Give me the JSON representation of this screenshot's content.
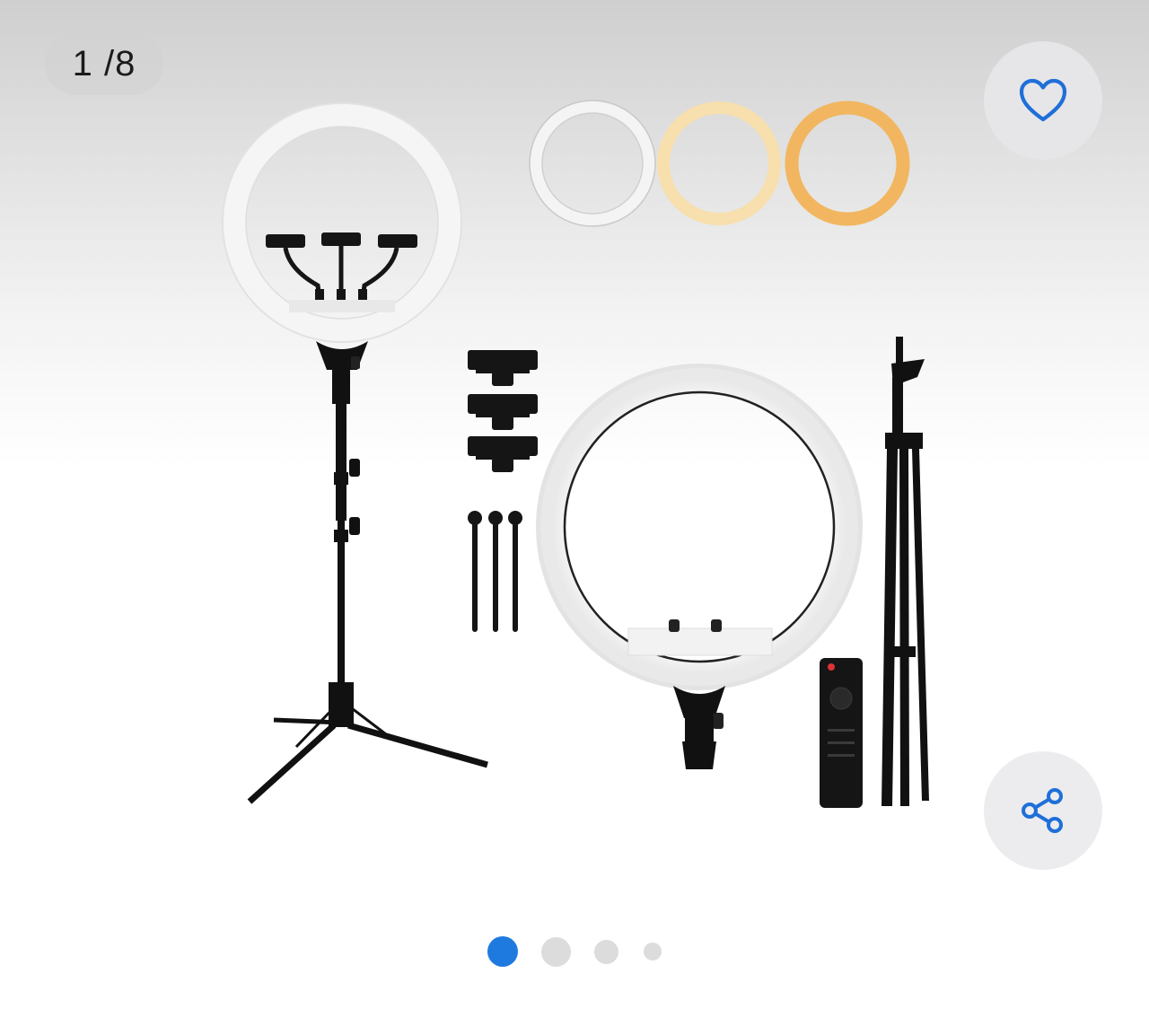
{
  "gallery": {
    "counter": "1 /8",
    "current_index": 1,
    "total_images": 8,
    "image_icon": "ring-light-kit-photo",
    "pagination_dots": 4,
    "active_dot": 0
  },
  "actions": {
    "favorite_icon": "heart-icon",
    "share_icon": "share-icon"
  },
  "colors": {
    "accent": "#1f7ae0",
    "inactive_dot": "#dcdcdc",
    "button_bg": "#e6e6e9"
  }
}
